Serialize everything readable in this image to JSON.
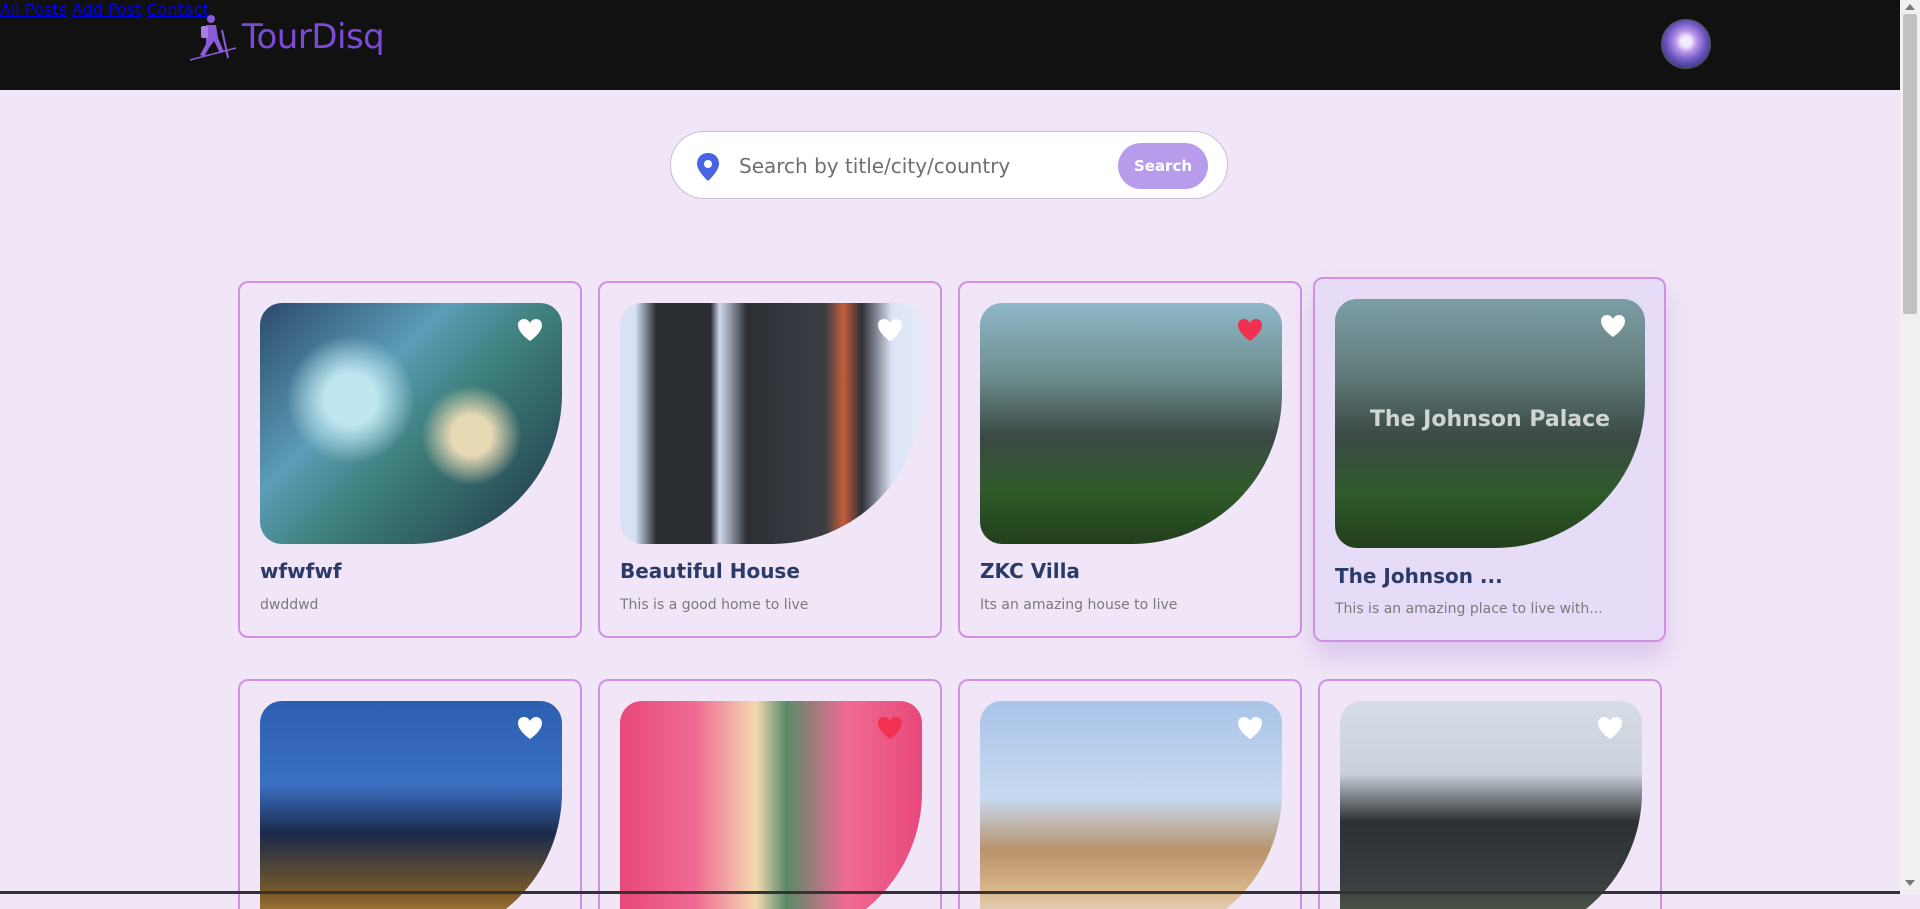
{
  "brand": {
    "name": "TourDisq"
  },
  "nav": [
    {
      "label": "All Posts"
    },
    {
      "label": "Add Post"
    },
    {
      "label": "Contact"
    }
  ],
  "search": {
    "placeholder": "Search by title/city/country",
    "value": "",
    "button_label": "Search"
  },
  "colors": {
    "header": "#121111",
    "brand": "#7b4bd6",
    "page_bg": "#f1e6f7",
    "card_border": "#d38fe6",
    "liked": "#f2304f",
    "search_button": "#b89cec"
  },
  "cards": [
    {
      "title": "wfwfwf",
      "description": "dwddwd",
      "liked": false
    },
    {
      "title": "Beautiful House",
      "description": "This is a good home to live",
      "liked": false
    },
    {
      "title": "ZKC Villa",
      "description": "Its an amazing house to live",
      "liked": true
    },
    {
      "title": "The Johnson ...",
      "description": "This is an amazing place to live with...",
      "overlay": "The Johnson Palace",
      "liked": false
    },
    {
      "liked": false
    },
    {
      "liked": true
    },
    {
      "liked": false
    },
    {
      "liked": false
    }
  ]
}
